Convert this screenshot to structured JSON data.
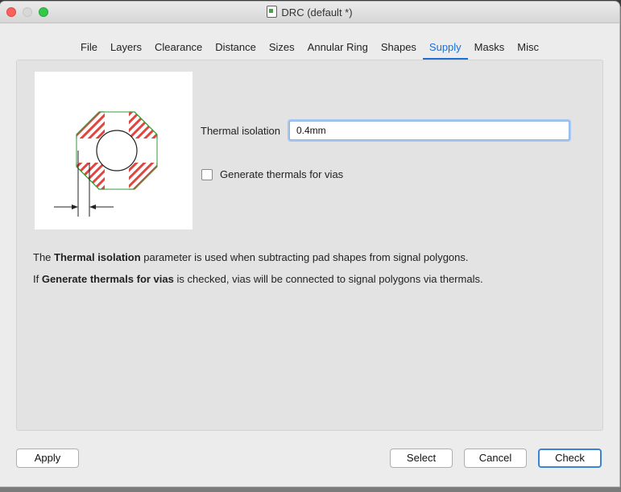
{
  "window": {
    "title": "DRC (default *)"
  },
  "tabs": [
    {
      "label": "File"
    },
    {
      "label": "Layers"
    },
    {
      "label": "Clearance"
    },
    {
      "label": "Distance"
    },
    {
      "label": "Sizes"
    },
    {
      "label": "Annular Ring"
    },
    {
      "label": "Shapes"
    },
    {
      "label": "Supply"
    },
    {
      "label": "Masks"
    },
    {
      "label": "Misc"
    }
  ],
  "active_tab": "Supply",
  "supply": {
    "thermal_label": "Thermal isolation",
    "thermal_value": "0.4mm",
    "vias_checkbox_label": "Generate thermals for vias",
    "vias_checked": false,
    "desc1": {
      "pre": "The ",
      "bold": "Thermal isolation",
      "post": " parameter is used when subtracting pad shapes from signal polygons."
    },
    "desc2": {
      "pre": "If ",
      "bold": "Generate thermals for vias",
      "post": " is checked, vias will be connected to signal polygons via thermals."
    }
  },
  "buttons": {
    "apply": "Apply",
    "select": "Select",
    "cancel": "Cancel",
    "check": "Check"
  },
  "colors": {
    "accent": "#1c6fd6",
    "hatch": "#e0453f",
    "outline": "#3a9a3a"
  }
}
